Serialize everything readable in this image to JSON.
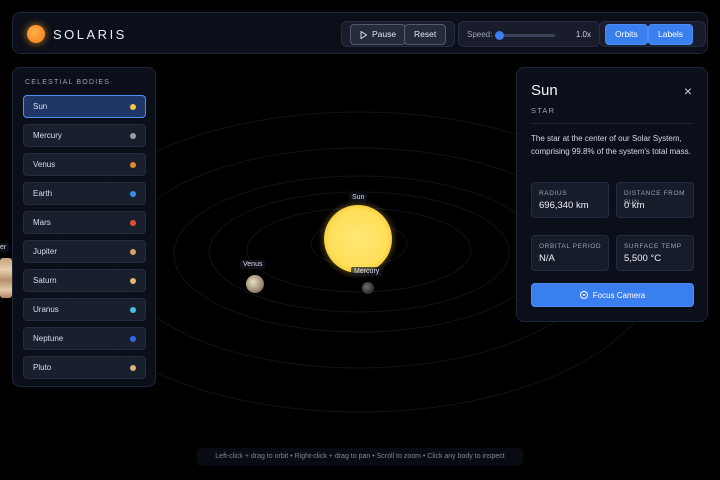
{
  "app": {
    "brand": "SOLARIS"
  },
  "toolbar": {
    "pause_label": "Pause",
    "reset_label": "Reset",
    "speed_label": "Speed:",
    "speed_value": "1.0x",
    "speed_fraction": 0.0,
    "orbits_label": "Orbits",
    "labels_label": "Labels"
  },
  "sidebar": {
    "title": "CELESTIAL BODIES",
    "selected": "Sun",
    "items": [
      {
        "label": "Sun",
        "color": "#f5c542"
      },
      {
        "label": "Mercury",
        "color": "#9a9ea6"
      },
      {
        "label": "Venus",
        "color": "#e08a2a"
      },
      {
        "label": "Earth",
        "color": "#3a8af0"
      },
      {
        "label": "Mars",
        "color": "#e0503a"
      },
      {
        "label": "Jupiter",
        "color": "#d8a06a"
      },
      {
        "label": "Saturn",
        "color": "#e3b876"
      },
      {
        "label": "Uranus",
        "color": "#4ac0e0"
      },
      {
        "label": "Neptune",
        "color": "#2f6ae0"
      },
      {
        "label": "Pluto",
        "color": "#d7b27a"
      }
    ]
  },
  "info": {
    "title": "Sun",
    "type": "STAR",
    "description": "The star at the center of our Solar System, comprising 99.8% of the system's total mass.",
    "stats": [
      {
        "label": "RADIUS",
        "value": "696,340 km"
      },
      {
        "label": "DISTANCE FROM SUN",
        "value": "0 km"
      },
      {
        "label": "ORBITAL PERIOD",
        "value": "N/A"
      },
      {
        "label": "SURFACE TEMP",
        "value": "5,500 °C"
      }
    ],
    "focus_label": "Focus Camera"
  },
  "scene": {
    "labels": {
      "sun": "Sun",
      "venus": "Venus",
      "mercury": "Mercury",
      "offscreen": "er"
    },
    "hint": "Left-click + drag to orbit • Right-click + drag to pan • Scroll to zoom • Click any body to inspect"
  },
  "colors": {
    "accent": "#3a7ff0",
    "sun": "#ffe066",
    "background": "#000000"
  }
}
